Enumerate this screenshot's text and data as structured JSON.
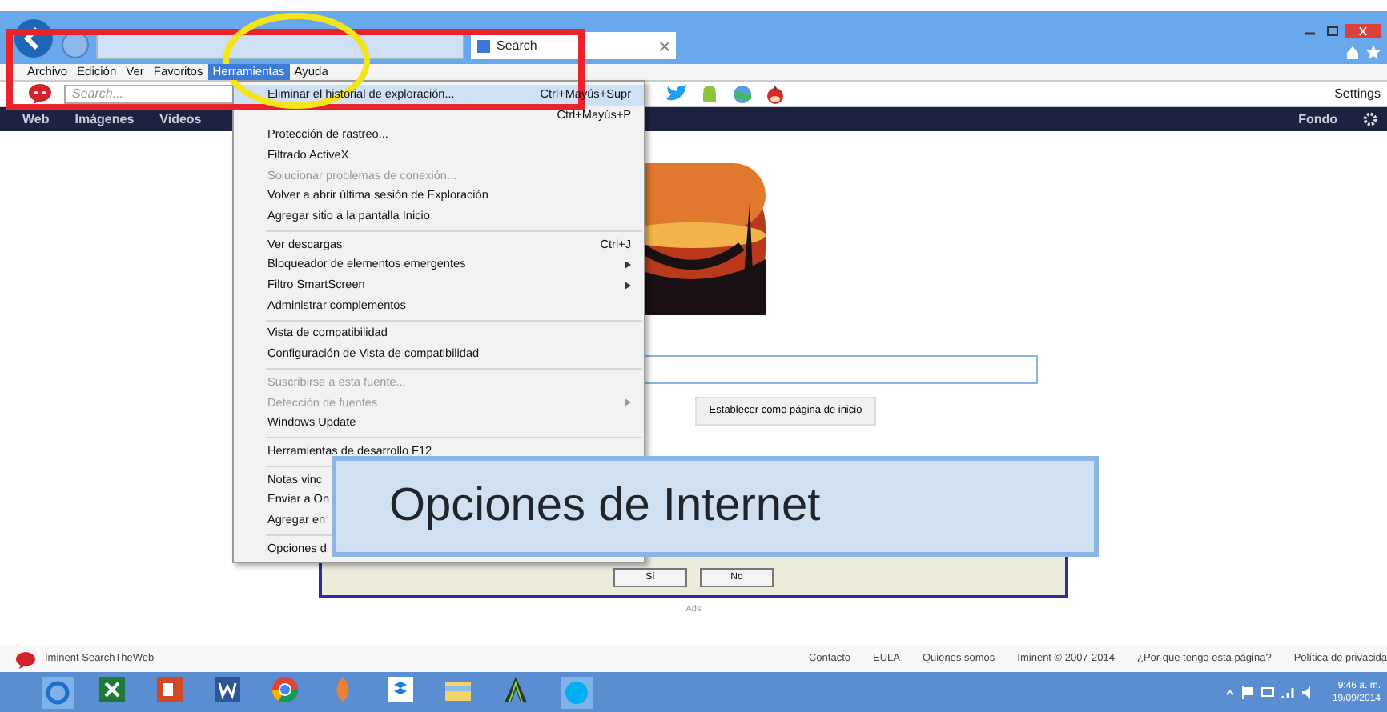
{
  "browser": {
    "tab_title": "Search",
    "search_placeholder": "Search...",
    "settings": "Settings"
  },
  "menubar": [
    {
      "label": "Archivo",
      "selected": false
    },
    {
      "label": "Edición",
      "selected": false
    },
    {
      "label": "Ver",
      "selected": false
    },
    {
      "label": "Favoritos",
      "selected": false
    },
    {
      "label": "Herramientas",
      "selected": true
    },
    {
      "label": "Ayuda",
      "selected": false
    }
  ],
  "nav": {
    "items": [
      "Web",
      "Imágenes",
      "Videos"
    ],
    "background_link": "Fondo"
  },
  "tools_menu": [
    {
      "kind": "item",
      "label": "Eliminar el historial de exploración...",
      "shortcut": "Ctrl+Mayús+Supr",
      "selected": true,
      "disabled": false
    },
    {
      "kind": "item",
      "shortcut": "Ctrl+Mayús+P",
      "selected": false,
      "disabled": false
    },
    {
      "kind": "item",
      "label": "Protección de rastreo...",
      "selected": false,
      "disabled": false
    },
    {
      "kind": "item",
      "label": "Filtrado ActiveX",
      "selected": false,
      "disabled": false
    },
    {
      "kind": "item",
      "label": "Solucionar problemas de conexión...",
      "selected": false,
      "disabled": true
    },
    {
      "kind": "item",
      "label": "Volver a abrir última sesión de Exploración",
      "selected": false,
      "disabled": false
    },
    {
      "kind": "item",
      "label": "Agregar sitio a la pantalla Inicio",
      "selected": false,
      "disabled": false
    },
    {
      "kind": "separator"
    },
    {
      "kind": "item",
      "label": "Ver descargas",
      "shortcut": "Ctrl+J",
      "selected": false,
      "disabled": false
    },
    {
      "kind": "item",
      "label": "Bloqueador de elementos emergentes",
      "submenu": true,
      "selected": false,
      "disabled": false
    },
    {
      "kind": "item",
      "label": "Filtro SmartScreen",
      "submenu": true,
      "selected": false,
      "disabled": false
    },
    {
      "kind": "item",
      "label": "Administrar complementos",
      "selected": false,
      "disabled": false
    },
    {
      "kind": "separator"
    },
    {
      "kind": "item",
      "label": "Vista de compatibilidad",
      "selected": false,
      "disabled": false
    },
    {
      "kind": "item",
      "label": "Configuración de Vista de compatibilidad",
      "selected": false,
      "disabled": false
    },
    {
      "kind": "separator"
    },
    {
      "kind": "item",
      "label": "Suscribirse a esta fuente...",
      "selected": false,
      "disabled": true
    },
    {
      "kind": "item",
      "label": "Detección de fuentes",
      "submenu": true,
      "selected": false,
      "disabled": true
    },
    {
      "kind": "item",
      "label": "Windows Update",
      "selected": false,
      "disabled": false
    },
    {
      "kind": "separator"
    },
    {
      "kind": "item",
      "label": "Herramientas de desarrollo F12",
      "selected": false,
      "disabled": false
    },
    {
      "kind": "separator"
    },
    {
      "kind": "item",
      "label": "Notas vinc",
      "selected": false,
      "disabled": false
    },
    {
      "kind": "item",
      "label": "Enviar a On",
      "selected": false,
      "disabled": false
    },
    {
      "kind": "item",
      "label": "Agregar en",
      "selected": false,
      "disabled": false
    },
    {
      "kind": "separator"
    },
    {
      "kind": "item",
      "label": "Opciones d",
      "selected": false,
      "disabled": false
    }
  ],
  "page": {
    "homepage_button": "Establecer como página de inicio",
    "dialog_buttons": [
      "Sí",
      "No"
    ],
    "ads_label": "Ads"
  },
  "callout": "Opciones de  Internet",
  "footer": {
    "brand": "Iminent SearchTheWeb",
    "links": [
      "Contacto",
      "EULA",
      "Quienes somos",
      "Iminent © 2007-2014",
      "¿Por que tengo esta página?",
      "Política de privacida"
    ]
  },
  "taskbar": {
    "time": "9:46 a. m.",
    "date": "19/09/2014"
  }
}
